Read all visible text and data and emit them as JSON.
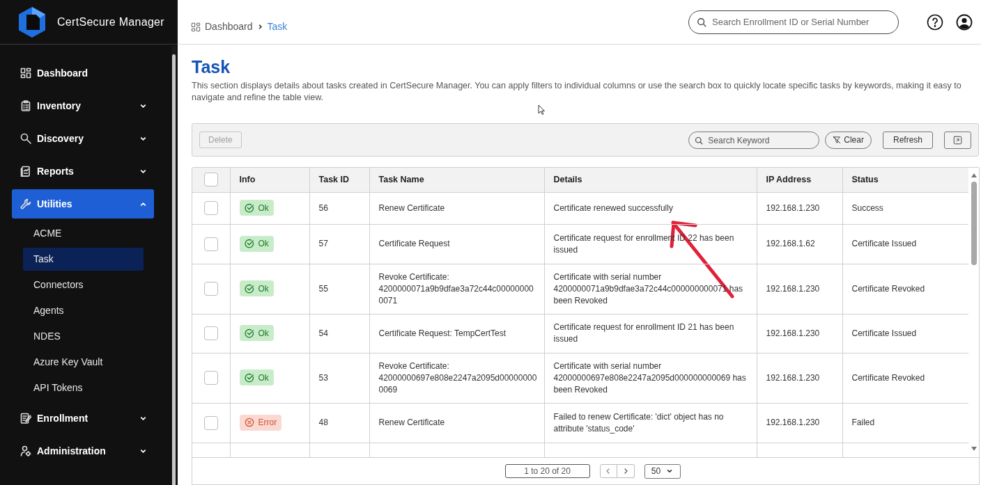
{
  "sidebar": {
    "brand": "CertSecure Manager",
    "items": [
      {
        "label": "Dashboard",
        "kind": "link",
        "selected": false
      },
      {
        "label": "Inventory",
        "kind": "group",
        "expanded": false,
        "selected": false
      },
      {
        "label": "Discovery",
        "kind": "group",
        "expanded": false,
        "selected": false
      },
      {
        "label": "Reports",
        "kind": "group",
        "expanded": false,
        "selected": false
      },
      {
        "label": "Utilities",
        "kind": "group",
        "expanded": true,
        "selected": true,
        "children": [
          {
            "label": "ACME",
            "selected": false
          },
          {
            "label": "Task",
            "selected": true
          },
          {
            "label": "Connectors",
            "selected": false
          },
          {
            "label": "Agents",
            "selected": false
          },
          {
            "label": "NDES",
            "selected": false
          },
          {
            "label": "Azure Key Vault",
            "selected": false
          },
          {
            "label": "API Tokens",
            "selected": false
          }
        ]
      },
      {
        "label": "Enrollment",
        "kind": "group",
        "expanded": false,
        "selected": false
      },
      {
        "label": "Administration",
        "kind": "group",
        "expanded": false,
        "selected": false
      }
    ]
  },
  "header": {
    "breadcrumb": [
      "Dashboard",
      "Task"
    ],
    "search": {
      "placeholder": "Search Enrollment ID or Serial Number"
    }
  },
  "page": {
    "title": "Task",
    "description": "This section displays details about tasks created in CertSecure Manager. You can apply filters to individual columns or use the search box to quickly locate specific tasks by keywords, making it easy to navigate and refine the table view."
  },
  "toolbar": {
    "delete": {
      "label": "Delete",
      "disabled": true
    },
    "search": {
      "placeholder": "Search Keyword"
    },
    "clear": "Clear",
    "refresh": "Refresh"
  },
  "table": {
    "select_all": {
      "checked": false
    },
    "columns": [
      "Info",
      "Task ID",
      "Task Name",
      "Details",
      "IP Address",
      "Status"
    ],
    "rows": [
      {
        "checked": false,
        "info": {
          "kind": "ok",
          "label": "Ok"
        },
        "task_id": "56",
        "task_name": "Renew Certificate",
        "details": "Certificate renewed successfully",
        "ip": "192.168.1.230",
        "status": "Success"
      },
      {
        "checked": false,
        "info": {
          "kind": "ok",
          "label": "Ok"
        },
        "task_id": "57",
        "task_name": "Certificate Request",
        "details": "Certificate request for enrollment ID 22 has been issued",
        "ip": "192.168.1.62",
        "status": "Certificate Issued"
      },
      {
        "checked": false,
        "info": {
          "kind": "ok",
          "label": "Ok"
        },
        "task_id": "55",
        "task_name": "Revoke Certificate: 4200000071a9b9dfae3a72c44c000000000071",
        "details": "Certificate with serial number 4200000071a9b9dfae3a72c44c000000000071 has been Revoked",
        "ip": "192.168.1.230",
        "status": "Certificate Revoked"
      },
      {
        "checked": false,
        "info": {
          "kind": "ok",
          "label": "Ok"
        },
        "task_id": "54",
        "task_name": "Certificate Request: TempCertTest",
        "details": "Certificate request for enrollment ID 21 has been issued",
        "ip": "192.168.1.230",
        "status": "Certificate Issued"
      },
      {
        "checked": false,
        "info": {
          "kind": "ok",
          "label": "Ok"
        },
        "task_id": "53",
        "task_name": "Revoke Certificate: 42000000697e808e2247a2095d000000000069",
        "details": "Certificate with serial number 42000000697e808e2247a2095d000000000069 has been Revoked",
        "ip": "192.168.1.230",
        "status": "Certificate Revoked"
      },
      {
        "checked": false,
        "info": {
          "kind": "error",
          "label": "Error"
        },
        "task_id": "48",
        "task_name": "Renew Certificate",
        "details": "Failed to renew Certificate: 'dict' object has no attribute 'status_code'",
        "ip": "192.168.1.230",
        "status": "Failed"
      }
    ]
  },
  "pagination": {
    "range": "1 to 20 of 20",
    "page_size": "50"
  },
  "annotation": {
    "kind": "arrow"
  }
}
